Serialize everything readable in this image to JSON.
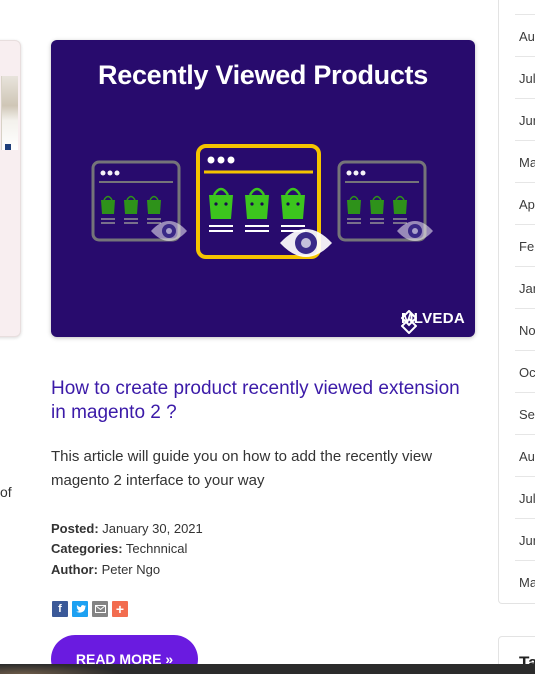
{
  "left_card": {
    "text_lines": [
      "",
      "of"
    ]
  },
  "hero": {
    "title": "Recently Viewed Products",
    "brand": "MLVEDA"
  },
  "post": {
    "title": "How to create product recently viewed extension in magento 2 ?",
    "excerpt": "This article will guide you on how to add the recently view magento 2 interface to your way",
    "posted_label": "Posted:",
    "posted_value": "January 30, 2021",
    "categories_label": "Categories:",
    "categories_value": "Technnical",
    "author_label": "Author:",
    "author_value": "Peter Ngo",
    "read_more": "READ MORE »"
  },
  "share_icons": [
    "facebook-icon",
    "twitter-icon",
    "email-icon",
    "plus-icon"
  ],
  "sidebar": {
    "archive": [
      "Au",
      "Jul",
      "Jun",
      "Ma",
      "Ap",
      "Feb",
      "Jan",
      "No",
      "Oc",
      "Se",
      "Au",
      "Jul",
      "Jun",
      "Ma"
    ],
    "tags_title": "Ta"
  },
  "colors": {
    "hero_bg": "#280b6d",
    "accent_yellow": "#f5c400",
    "bag_green": "#3cc51e",
    "title_purple": "#3b1aa8",
    "button_purple": "#6a1be0"
  }
}
